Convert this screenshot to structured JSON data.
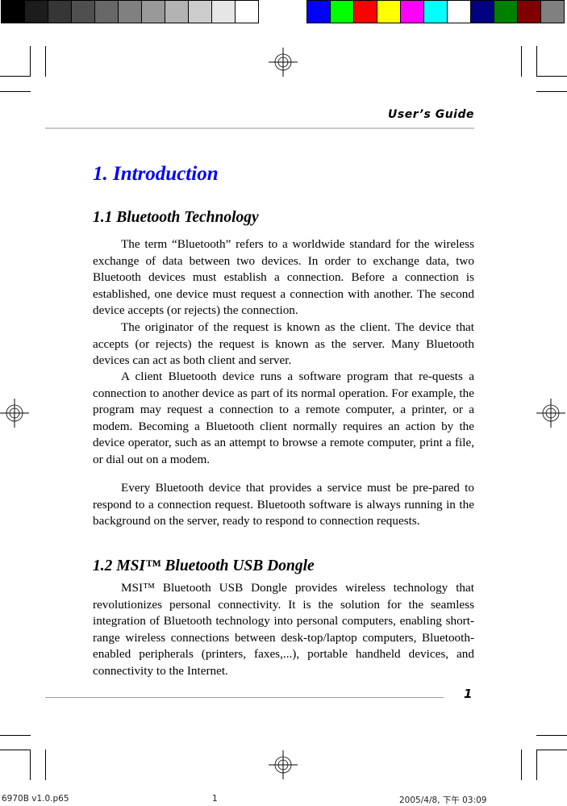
{
  "color_bar": {
    "grayscale": [
      "#000000",
      "#1c1c1c",
      "#363636",
      "#4f4f4f",
      "#686868",
      "#808080",
      "#999999",
      "#b3b3b3",
      "#cccccc",
      "#e6e6e6",
      "#ffffff"
    ],
    "colors": [
      "#0000ff",
      "#00ff00",
      "#ff0000",
      "#ffff00",
      "#ff00ff",
      "#00ffff",
      "#ffffff",
      "#000080",
      "#008000",
      "#800000",
      "#808080"
    ]
  },
  "header": {
    "running_title": "User’s Guide"
  },
  "chapter": {
    "title": "1. Introduction",
    "title_color": "#0000ff"
  },
  "sections": [
    {
      "title": "1.1  Bluetooth Technology",
      "paragraphs": [
        "The term “Bluetooth” refers to a worldwide standard for the wireless exchange of data between two devices. In order to exchange data, two Bluetooth devices must establish a connection. Before a connection is established, one device must request a connection with another. The second device accepts (or rejects) the connection.",
        "The originator of the request is known as the client. The device that accepts (or rejects) the request is known as the server. Many Bluetooth devices can act as both client and server.",
        "A client Bluetooth device runs a software program that re-quests a connection to another device as part of its normal operation. For example, the program may request a connection to a remote computer, a printer, or a modem. Becoming a Bluetooth client normally requires an action by the device operator, such as an attempt to browse a remote computer, print a file, or dial out on a modem.",
        "Every Bluetooth device that provides a service must be pre-pared to respond to a connection request. Bluetooth software is always running in the background on the server, ready to respond to connection requests."
      ]
    },
    {
      "title": "1.2  MSI™ Bluetooth USB Dongle",
      "paragraphs": [
        "MSI™ Bluetooth USB Dongle provides wireless technology that revolutionizes personal connectivity. It is the solution for the seamless integration of Bluetooth technology into personal computers, enabling short-range wireless connections between desk-top/laptop computers, Bluetooth-enabled peripherals (printers, faxes,...), portable handheld devices, and connectivity to the Internet."
      ]
    }
  ],
  "footer": {
    "page_number": "1"
  },
  "slug": {
    "filename": "6970B v1.0.p65",
    "page": "1",
    "timestamp": "2005/4/8, 下午 03:09"
  }
}
